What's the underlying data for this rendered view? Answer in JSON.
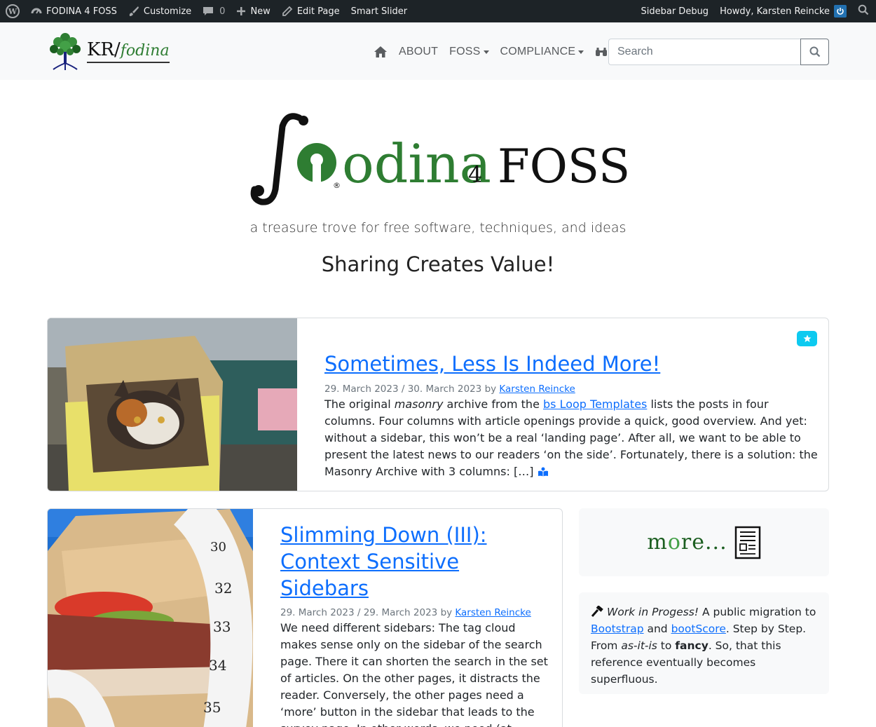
{
  "adminbar": {
    "site_name": "FODINA 4 FOSS",
    "customize": "Customize",
    "comments_count": "0",
    "new": "New",
    "edit_page": "Edit Page",
    "smart_slider": "Smart Slider",
    "sidebar_debug": "Sidebar Debug",
    "howdy": "Howdy, Karsten Reincke"
  },
  "navbar": {
    "brand_kr": "KR/",
    "brand_fodina": "fodina",
    "items": [
      {
        "label": "ABOUT",
        "dropdown": false
      },
      {
        "label": "FOSS",
        "dropdown": true
      },
      {
        "label": "COMPLIANCE",
        "dropdown": true
      }
    ],
    "search_placeholder": "Search"
  },
  "hero": {
    "logo_word": "odina",
    "logo_four": "4",
    "logo_foss": "FOSS",
    "tagline": "a treasure trove for free software, techniques, and ideas",
    "slogan": "Sharing Creates Value!"
  },
  "posts": [
    {
      "title": "Sometimes, Less Is Indeed More!",
      "published": "29. March 2023",
      "updated": "30. March 2023",
      "by": "by",
      "author": "Karsten Reincke",
      "excerpt_1": "The original ",
      "excerpt_em": "masonry",
      "excerpt_2": " archive from the ",
      "excerpt_link": "bs Loop Templates",
      "excerpt_3": " lists the posts in four columns. Four columns with article openings provide a quick, good overview. And yet: without a sidebar, this won’t be a real ‘landing page’. After all, we want to be able to present the latest news to our readers ‘on the side’. Fortunately, there is a solution: the Masonry Archive with 3 columns: […]"
    },
    {
      "title": "Slimming Down (III): Context Sensitive Sidebars",
      "published": "29. March 2023",
      "updated": "29. March 2023",
      "by": "by",
      "author": "Karsten Reincke",
      "excerpt": "We need different sidebars: The tag cloud makes sense only on the sidebar of the search page. There it can shorten the search in the set of articles. On the other pages, it distracts the reader. Conversely, the other pages need a ‘more’ button in the sidebar that leads to the survey page. In other words, we need (at"
    }
  ],
  "sidebar": {
    "more_m": "m",
    "more_o": "o",
    "more_rest": "re...",
    "wip_em": "Work in Progess!",
    "wip_1": " A public migration to ",
    "wip_link1": "Bootstrap",
    "wip_2": " and ",
    "wip_link2": "bootScore",
    "wip_3": ". Step by Step. From ",
    "wip_em2": "as-it-is",
    "wip_4": " to ",
    "wip_strong": "fancy",
    "wip_5": ". So, that this reference eventually becomes superfluous."
  },
  "colors": {
    "accent": "#0d6efd",
    "info_badge": "#0dcaf0",
    "adminbar": "#1d2327",
    "logo_green": "#2e7d32"
  }
}
